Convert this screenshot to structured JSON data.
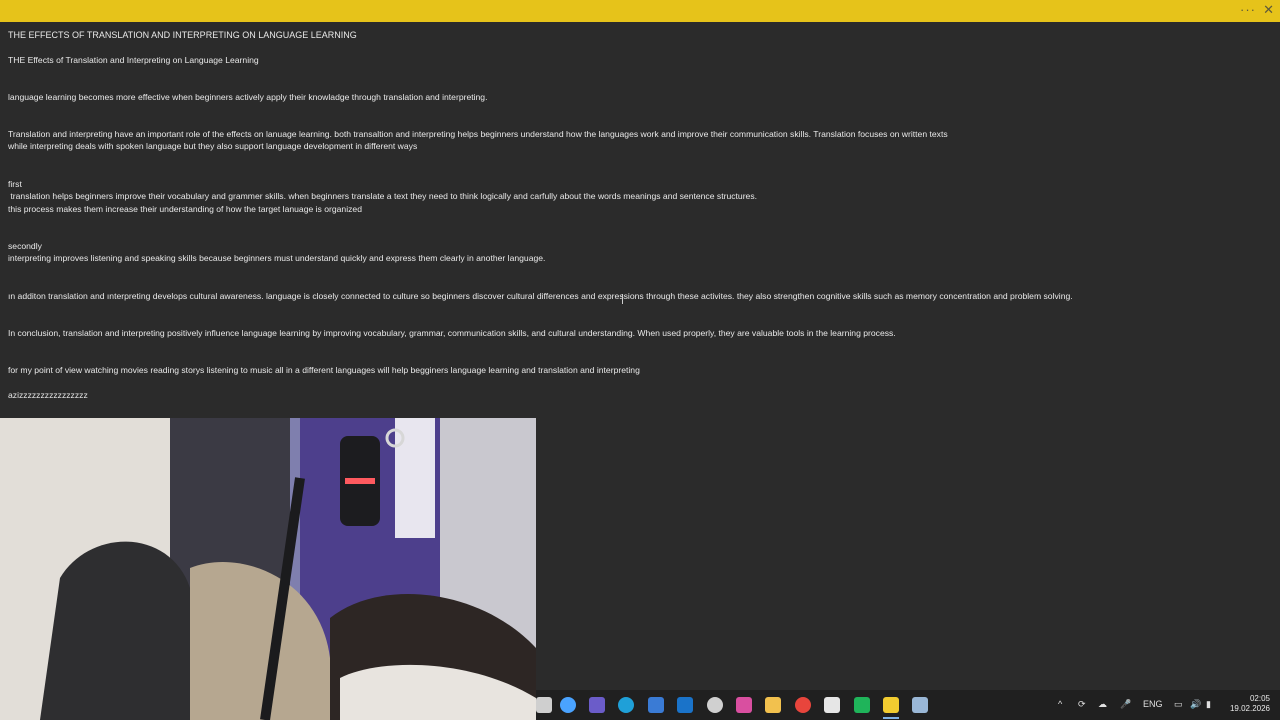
{
  "window": {
    "more_icon": "···",
    "close_icon": "✕"
  },
  "note": {
    "lines": [
      "THE EFFECTS OF TRANSLATION AND INTERPRETING ON LANGUAGE LEARNING",
      "THE Effects of Translation and Interpreting on Language Learning",
      "language learning becomes more effective when beginners actively apply their knowladge through translation and interpreting.",
      "Translation and interpreting have an important role of the effects on lanuage learning. both transaltion and interpreting helps beginners understand how the languages work and improve their communication skills. Translation focuses on written texts",
      "while interpreting deals with spoken language but they also support language development in different ways",
      "first",
      " translation helps beginners improve their vocabulary and grammer skills. when beginners translate a text they need to think logically and carfully about the words meanings and sentence structures.",
      "this process makes them increase their understanding of how the target lanuage is organized",
      "secondly",
      "interpreting improves listening and speaking skills because beginners must understand quickly and express them clearly in another language.",
      "ın additon translation and ınterpreting develops cultural awareness. language is closely connected to culture so beginners discover cultural differences and expressions through these activites. they also strengthen cognitive skills such as memory concentration and problem solving.",
      "In conclusion, translation and interpreting positively influence language learning by improving vocabulary, grammar, communication skills, and cultural understanding. When used properly, they are valuable tools in the learning process.",
      "for my point of view watching movies reading storys listening to music all in a different languages will help begginers language learning and translation and interpreting",
      "azizzzzzzzzzzzzzzzz"
    ]
  },
  "taskbar": {
    "icons": [
      "file-explorer-icon",
      "copilot-icon",
      "teams-icon",
      "edge-icon",
      "store-icon",
      "outlook-icon",
      "alienware-icon",
      "ms365-icon",
      "folder-icon",
      "chrome-icon",
      "capcut-icon",
      "whatsapp-icon",
      "sticky-notes-icon",
      "steam-icon"
    ],
    "icon_colors": [
      "#cfcfcf",
      "#4aa3ff",
      "#6b5cc9",
      "#1fa0d8",
      "#3a7bd5",
      "#1a73c9",
      "#d0d0d0",
      "#d94fa0",
      "#f2c14e",
      "#e8453c",
      "#e6e6e6",
      "#1fb45a",
      "#f2cc30",
      "#9ab7d6"
    ],
    "tray_chevron": "^",
    "language": "ENG",
    "time": "02:05",
    "date": "19.02.2026"
  },
  "colors": {
    "titlebar": "#e6c31a",
    "background": "#2b2b2b",
    "text": "#e9e9e9",
    "taskbar": "#202020"
  }
}
